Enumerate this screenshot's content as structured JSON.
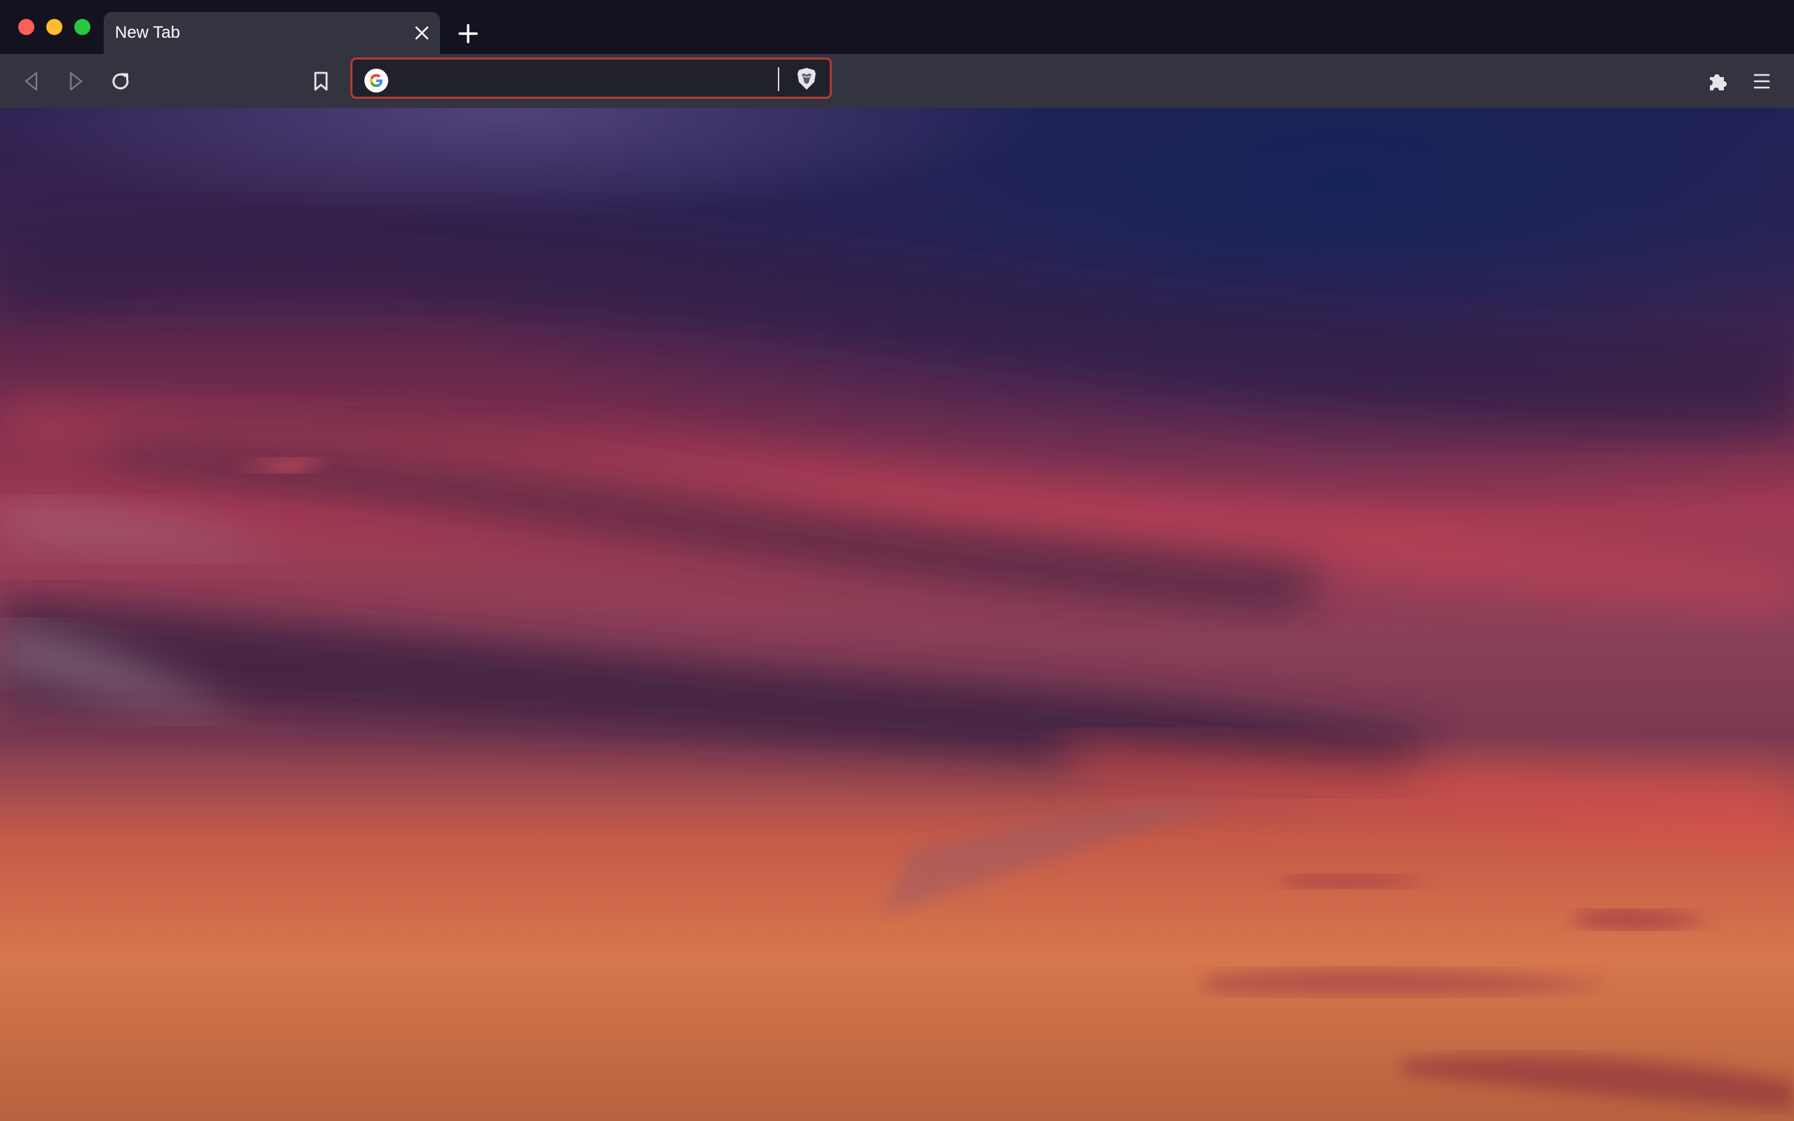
{
  "window": {
    "controls": [
      "close",
      "minimize",
      "zoom"
    ]
  },
  "tabs": [
    {
      "title": "New Tab",
      "active": true
    }
  ],
  "toolbar": {
    "back_icon": "back-arrow-icon",
    "forward_icon": "forward-arrow-icon",
    "reload_icon": "reload-icon",
    "bookmark_icon": "bookmark-icon",
    "extensions_icon": "puzzle-icon",
    "menu_icon": "hamburger-menu-icon"
  },
  "omnibox": {
    "value": "",
    "search_engine_icon": "google-icon",
    "shields_icon": "brave-shields-icon",
    "focus_color": "#b23a3a"
  },
  "colors": {
    "titlebar": "#12131f",
    "toolbar": "#33343f",
    "omnibox_bg": "#20212b",
    "traffic_close": "#ff5f57",
    "traffic_minimize": "#febc2e",
    "traffic_zoom": "#28c840"
  },
  "background": {
    "type": "sunset-sky-photo"
  }
}
